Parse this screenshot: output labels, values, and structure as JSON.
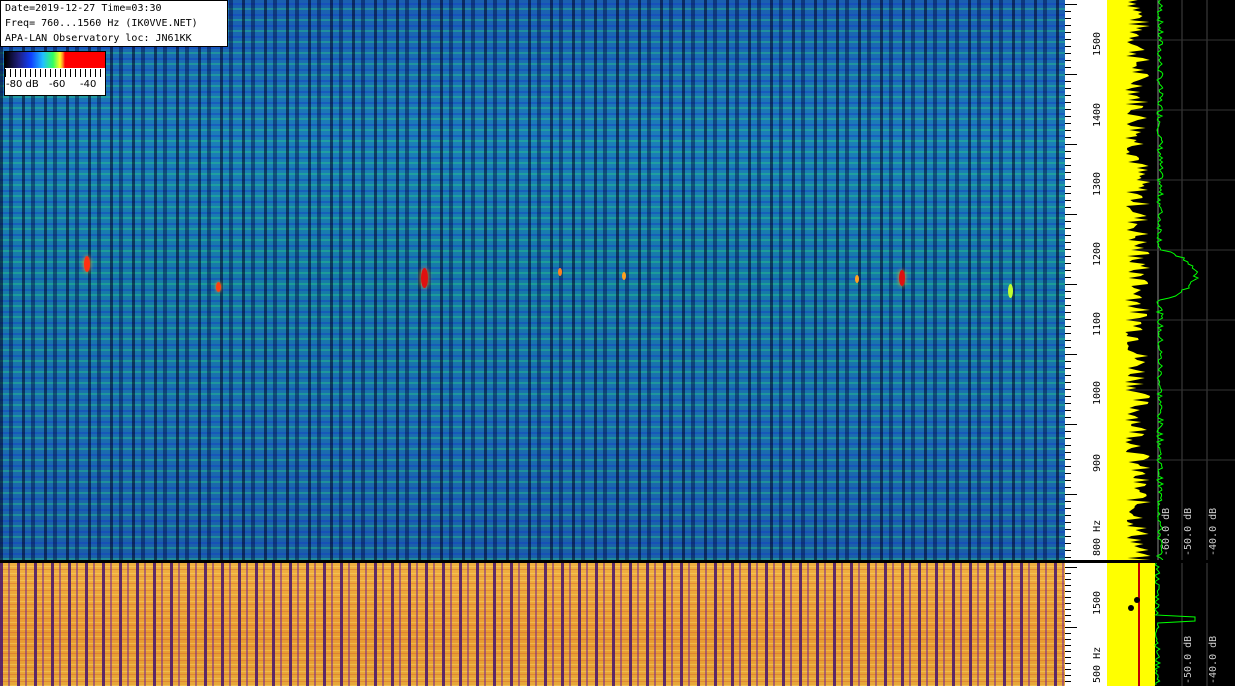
{
  "info": {
    "line1": "Date=2019-12-27 Time=03:30",
    "line2": "Freq= 760...1560 Hz (IK0VVE.NET)",
    "line3": "APA-LAN Observatory loc: JN61KK"
  },
  "legend": {
    "label_a": "-80 dB",
    "label_b": "-60",
    "label_c": "-40"
  },
  "scale_top": {
    "labels": [
      "1500",
      "1400",
      "1300",
      "1200",
      "1100",
      "1000",
      "900",
      "800 Hz"
    ]
  },
  "scale_bottom": {
    "labels": [
      "1500",
      "500 Hz"
    ]
  },
  "spectrum_top": {
    "db_labels": [
      "-60.0 dB",
      "-50.0 dB",
      "-40.0 dB"
    ]
  },
  "spectrum_bottom": {
    "db_labels": [
      "-60.0 dB",
      "-50.0 dB",
      "-40.0 dB"
    ]
  },
  "colors": {
    "spectrum_fill": "#ffff00",
    "spectrum_line": "#00ff00",
    "marker": "#ff0000"
  }
}
